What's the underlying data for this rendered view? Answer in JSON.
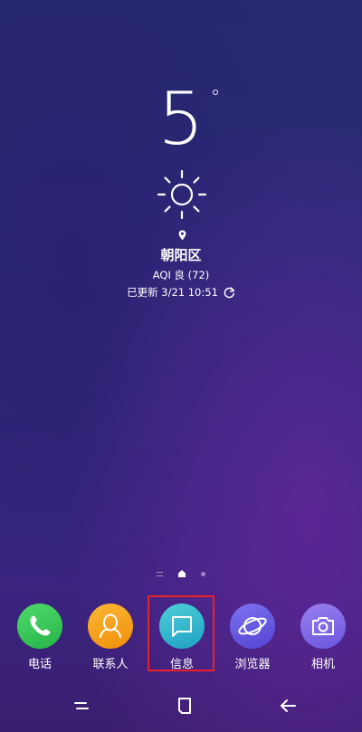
{
  "weather": {
    "temperature": "5",
    "unit": "°",
    "condition_icon": "sun-icon",
    "location": "朝阳区",
    "aqi": "AQI 良 (72)",
    "updated": "已更新 3/21 10:51"
  },
  "page_indicator": {
    "pages": [
      "lines",
      "home",
      "dot"
    ],
    "active": "home"
  },
  "dock": {
    "apps": [
      {
        "label": "电话",
        "icon": "phone-icon",
        "color": "#3ecb5a"
      },
      {
        "label": "联系人",
        "icon": "contacts-icon",
        "color": "#f6a21b"
      },
      {
        "label": "信息",
        "icon": "message-icon",
        "color": "#2ec0c9",
        "highlighted": true
      },
      {
        "label": "浏览器",
        "icon": "browser-icon",
        "color": "#6a5be0"
      },
      {
        "label": "相机",
        "icon": "camera-icon",
        "color": "#7d66e6"
      }
    ]
  },
  "highlight_color": "#e8222c",
  "navigation": {
    "buttons": [
      "recents-icon",
      "home-icon",
      "back-icon"
    ]
  }
}
